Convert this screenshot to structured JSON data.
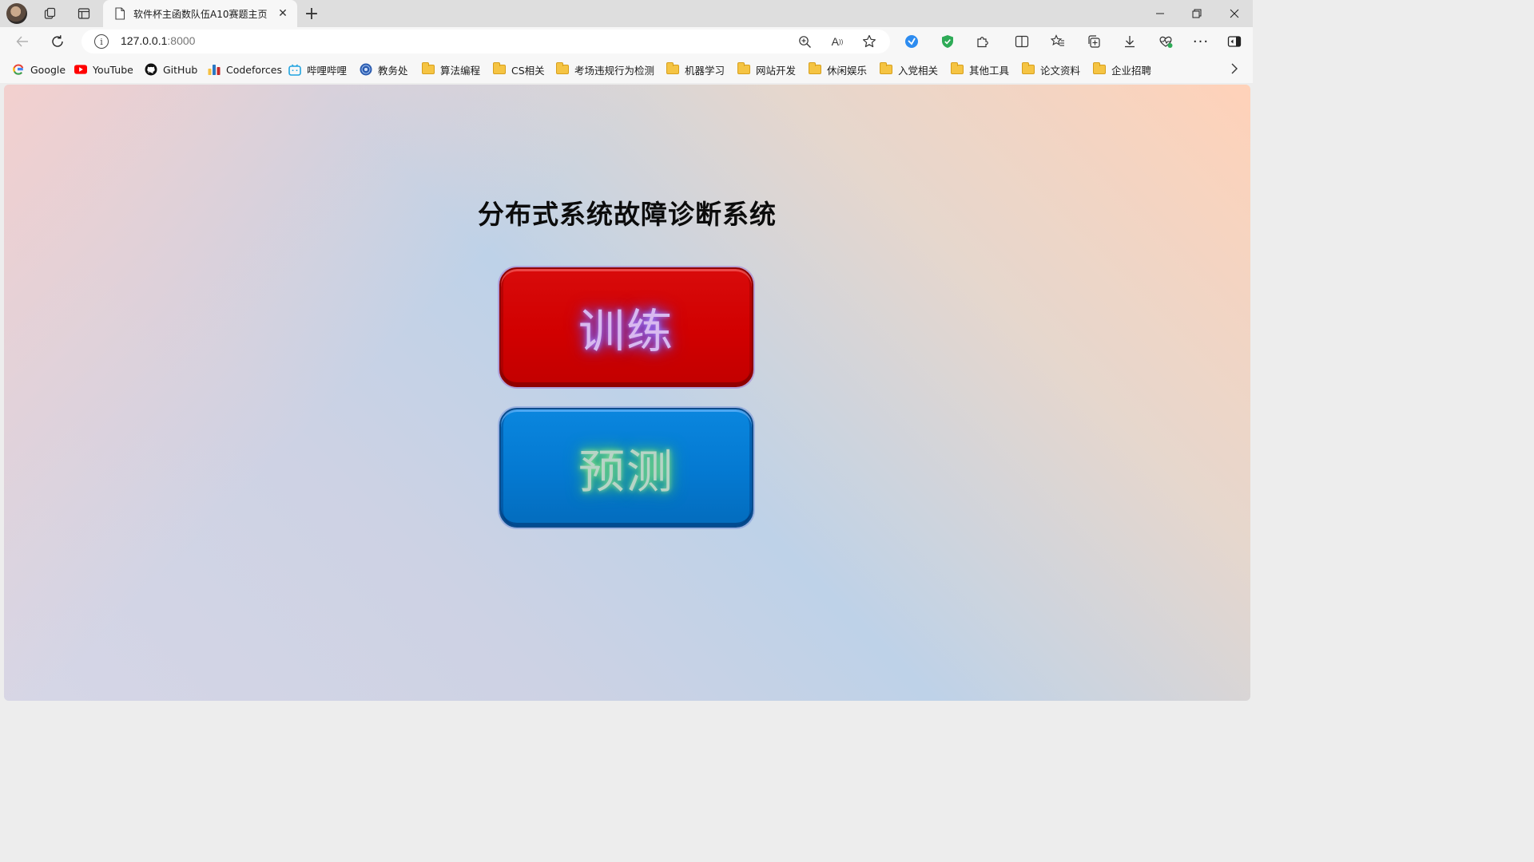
{
  "browser": {
    "tab": {
      "title": "软件杯主函数队伍A10赛题主页",
      "close_glyph": "✕",
      "new_tab_glyph": "+"
    },
    "window_controls": {
      "minimize_glyph": "—",
      "restore_glyph": "❐",
      "close_glyph": "✕"
    },
    "address_bar": {
      "host": "127.0.0.1",
      "port": ":8000"
    },
    "icons": {
      "profile": "avatar-icon",
      "workspaces": "workspaces-icon",
      "tab_actions": "vertical-tabs-icon",
      "back": "back-arrow-icon",
      "refresh": "refresh-icon",
      "info": "site-info-icon",
      "zoom": "zoom-icon",
      "read_aloud": "read-aloud-icon",
      "favorite": "star-icon",
      "ext1": "extension-shield-blue-icon",
      "ext2": "extension-shield-green-icon",
      "extensions": "puzzle-icon",
      "split": "split-screen-icon",
      "favorites": "favorites-icon",
      "collections": "collections-icon",
      "downloads": "download-icon",
      "performance": "performance-icon",
      "more": "more-icon",
      "sidebar": "sidebar-icon"
    }
  },
  "bookmarks": [
    {
      "label": "Google",
      "icon": "google-icon"
    },
    {
      "label": "YouTube",
      "icon": "youtube-icon"
    },
    {
      "label": "GitHub",
      "icon": "github-icon"
    },
    {
      "label": "Codeforces",
      "icon": "codeforces-icon"
    },
    {
      "label": "哔哩哔哩",
      "icon": "bilibili-icon"
    },
    {
      "label": "教务处",
      "icon": "school-icon"
    },
    {
      "label": "算法编程",
      "icon": "folder-icon"
    },
    {
      "label": "CS相关",
      "icon": "folder-icon"
    },
    {
      "label": "考场违规行为检测",
      "icon": "folder-icon"
    },
    {
      "label": "机器学习",
      "icon": "folder-icon"
    },
    {
      "label": "网站开发",
      "icon": "folder-icon"
    },
    {
      "label": "休闲娱乐",
      "icon": "folder-icon"
    },
    {
      "label": "入党相关",
      "icon": "folder-icon"
    },
    {
      "label": "其他工具",
      "icon": "folder-icon"
    },
    {
      "label": "论文资料",
      "icon": "folder-icon"
    },
    {
      "label": "企业招聘",
      "icon": "folder-icon"
    }
  ],
  "page": {
    "heading": "分布式系统故障诊断系统",
    "train_button": "训练",
    "predict_button": "预测",
    "colors": {
      "train_bg": "#d10000",
      "predict_bg": "#0479d1"
    }
  }
}
